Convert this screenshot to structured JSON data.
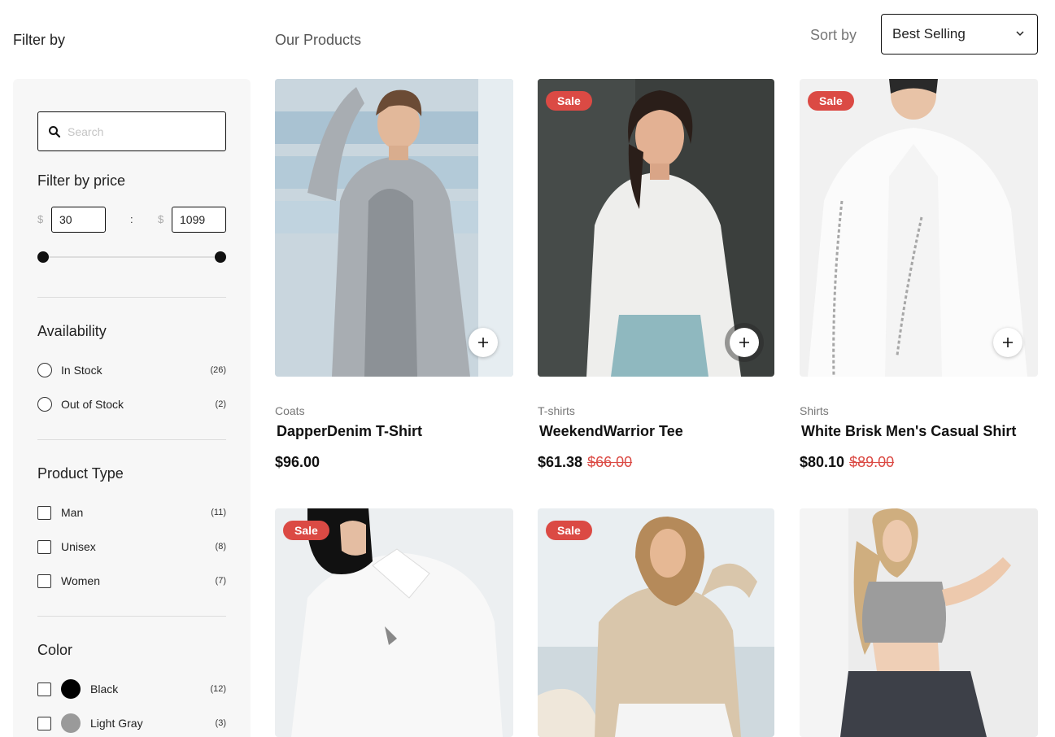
{
  "header": {
    "filter_title": "Filter by",
    "products_title": "Our Products",
    "sort_label": "Sort by",
    "sort_value": "Best Selling"
  },
  "sidebar": {
    "search_placeholder": "Search",
    "price": {
      "title": "Filter by price",
      "currency": "$",
      "separator": ":",
      "min": "30",
      "max": "1099"
    },
    "availability": {
      "title": "Availability",
      "options": [
        {
          "label": "In Stock",
          "count": "(26)"
        },
        {
          "label": "Out of Stock",
          "count": "(2)"
        }
      ]
    },
    "product_type": {
      "title": "Product Type",
      "options": [
        {
          "label": "Man",
          "count": "(11)"
        },
        {
          "label": "Unisex",
          "count": "(8)"
        },
        {
          "label": "Women",
          "count": "(7)"
        }
      ]
    },
    "color": {
      "title": "Color",
      "options": [
        {
          "label": "Black",
          "count": "(12)",
          "swatch": "#000000"
        },
        {
          "label": "Light Gray",
          "count": "(3)",
          "swatch": "#9a9a9a"
        }
      ]
    }
  },
  "products": [
    {
      "category": "Coats",
      "name": "DapperDenim T-Shirt",
      "price": "$96.00",
      "old_price": "",
      "sale": ""
    },
    {
      "category": "T-shirts",
      "name": "WeekendWarrior Tee",
      "price": "$61.38",
      "old_price": "$66.00",
      "sale": "Sale"
    },
    {
      "category": "Shirts",
      "name": "White Brisk Men's Casual Shirt",
      "price": "$80.10",
      "old_price": "$89.00",
      "sale": "Sale"
    },
    {
      "sale": "Sale"
    },
    {
      "sale": "Sale"
    },
    {
      "sale": ""
    }
  ],
  "colors": {
    "sale_badge": "#db4a44",
    "accent": "#111111"
  }
}
